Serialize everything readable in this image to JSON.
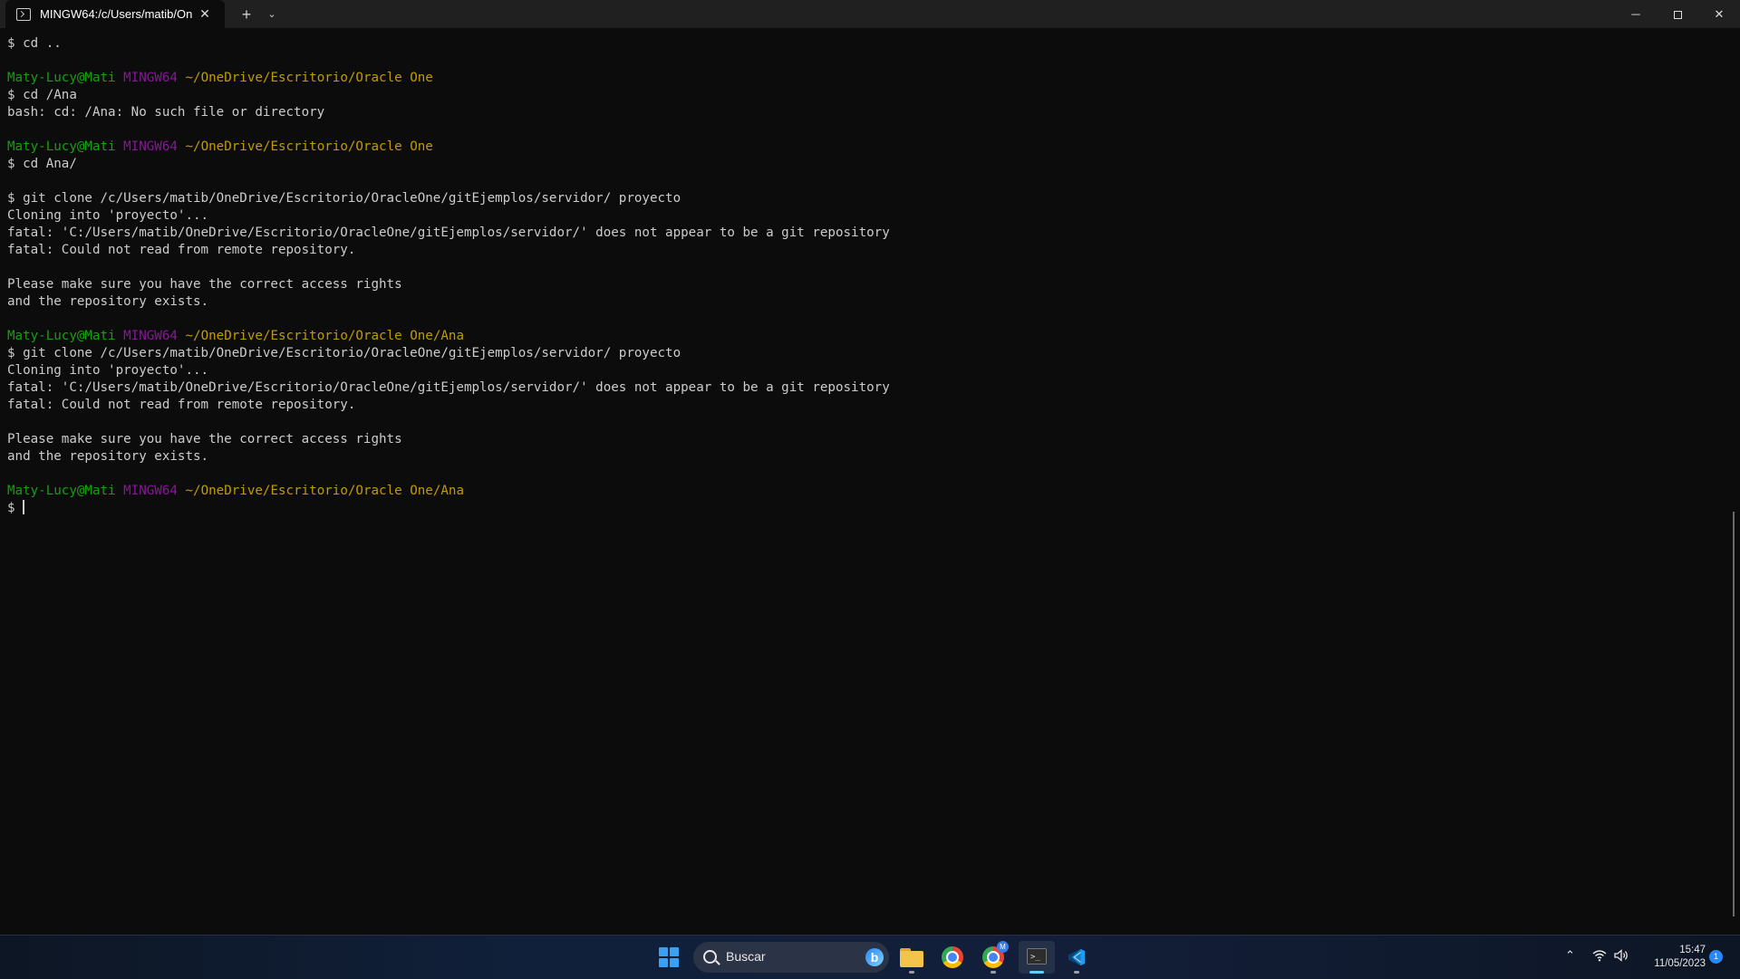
{
  "window": {
    "tab_title": "MINGW64:/c/Users/matib/On",
    "tab_close": "✕",
    "new_tab": "+",
    "tab_dropdown": "⌄",
    "minimize": "─",
    "close": "✕"
  },
  "terminal": {
    "lines": [
      {
        "type": "text",
        "text": "$ cd .."
      },
      {
        "type": "blank"
      },
      {
        "type": "prompt",
        "user": "Maty-Lucy@Mati",
        "host": "MINGW64",
        "path": "~/OneDrive/Escritorio/Oracle One"
      },
      {
        "type": "text",
        "text": "$ cd /Ana"
      },
      {
        "type": "text",
        "text": "bash: cd: /Ana: No such file or directory"
      },
      {
        "type": "blank"
      },
      {
        "type": "prompt",
        "user": "Maty-Lucy@Mati",
        "host": "MINGW64",
        "path": "~/OneDrive/Escritorio/Oracle One"
      },
      {
        "type": "text",
        "text": "$ cd Ana/"
      },
      {
        "type": "blank"
      },
      {
        "type": "text",
        "text": "$ git clone /c/Users/matib/OneDrive/Escritorio/OracleOne/gitEjemplos/servidor/ proyecto"
      },
      {
        "type": "text",
        "text": "Cloning into 'proyecto'..."
      },
      {
        "type": "text",
        "text": "fatal: 'C:/Users/matib/OneDrive/Escritorio/OracleOne/gitEjemplos/servidor/' does not appear to be a git repository"
      },
      {
        "type": "text",
        "text": "fatal: Could not read from remote repository."
      },
      {
        "type": "blank"
      },
      {
        "type": "text",
        "text": "Please make sure you have the correct access rights"
      },
      {
        "type": "text",
        "text": "and the repository exists."
      },
      {
        "type": "blank"
      },
      {
        "type": "prompt",
        "user": "Maty-Lucy@Mati",
        "host": "MINGW64",
        "path": "~/OneDrive/Escritorio/Oracle One/Ana"
      },
      {
        "type": "text",
        "text": "$ git clone /c/Users/matib/OneDrive/Escritorio/OracleOne/gitEjemplos/servidor/ proyecto"
      },
      {
        "type": "text",
        "text": "Cloning into 'proyecto'..."
      },
      {
        "type": "text",
        "text": "fatal: 'C:/Users/matib/OneDrive/Escritorio/OracleOne/gitEjemplos/servidor/' does not appear to be a git repository"
      },
      {
        "type": "text",
        "text": "fatal: Could not read from remote repository."
      },
      {
        "type": "blank"
      },
      {
        "type": "text",
        "text": "Please make sure you have the correct access rights"
      },
      {
        "type": "text",
        "text": "and the repository exists."
      },
      {
        "type": "blank"
      },
      {
        "type": "prompt",
        "user": "Maty-Lucy@Mati",
        "host": "MINGW64",
        "path": "~/OneDrive/Escritorio/Oracle One/Ana"
      },
      {
        "type": "input",
        "text": "$ "
      }
    ]
  },
  "colors": {
    "user": "#13a10e",
    "host": "#881798",
    "path": "#c19c00",
    "text": "#cccccc",
    "background": "#0c0c0c"
  },
  "taskbar": {
    "search_placeholder": "Buscar",
    "bing_letter": "b",
    "chrome_badge": "M",
    "terminal_glyph": ">_",
    "icons": [
      "windows-start-icon",
      "search-icon",
      "bing-icon",
      "file-explorer-icon",
      "chrome-icon",
      "chrome-profile-icon",
      "terminal-icon",
      "vscode-icon"
    ],
    "tray": {
      "chevron": "⌃",
      "wifi": "◠",
      "volume": "🔈",
      "time": "15:47",
      "date": "11/05/2023",
      "notifications": "1"
    }
  }
}
